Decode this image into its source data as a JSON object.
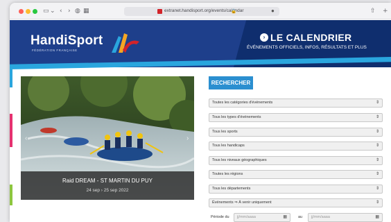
{
  "browser": {
    "url": "extranet.handisport.org/events/calendar",
    "icons": [
      "sidebar-icon",
      "chevron-down-icon",
      "back-icon",
      "forward-icon",
      "shield-icon",
      "tab-grid-icon",
      "lock-icon",
      "download-icon",
      "share-icon",
      "new-tab-icon"
    ]
  },
  "header": {
    "logo": "HandiSport",
    "logo_sub": "FÉDÉRATION FRANÇAISE",
    "title": "LE CALENDRIER",
    "subtitle": "ÉVÉNEMENTS OFFICIELS, INFOS, RÉSULTATS ET PLUS",
    "colors": {
      "primary": "#1e3f8b",
      "dark": "#0f2e6e",
      "accent": "#2aa6de",
      "red": "#d2232a"
    }
  },
  "featured": {
    "title": "Raid DREAM - ST MARTIN DU PUY",
    "dates": "24 sep  ›  25 sep 2022"
  },
  "search": {
    "button": "RECHERCHER",
    "filters": [
      "Toutes les catégories d'événements",
      "Tous les types d'événements",
      "Tous les sports",
      "Tous les handicaps",
      "Tous les niveaux géographiques",
      "Toutes les régions",
      "Tous les départements",
      "Événements ⇒ À venir uniquement"
    ],
    "period_label": "Période du",
    "to_label": "au",
    "date_placeholder": "jj/mm/aaaa"
  }
}
